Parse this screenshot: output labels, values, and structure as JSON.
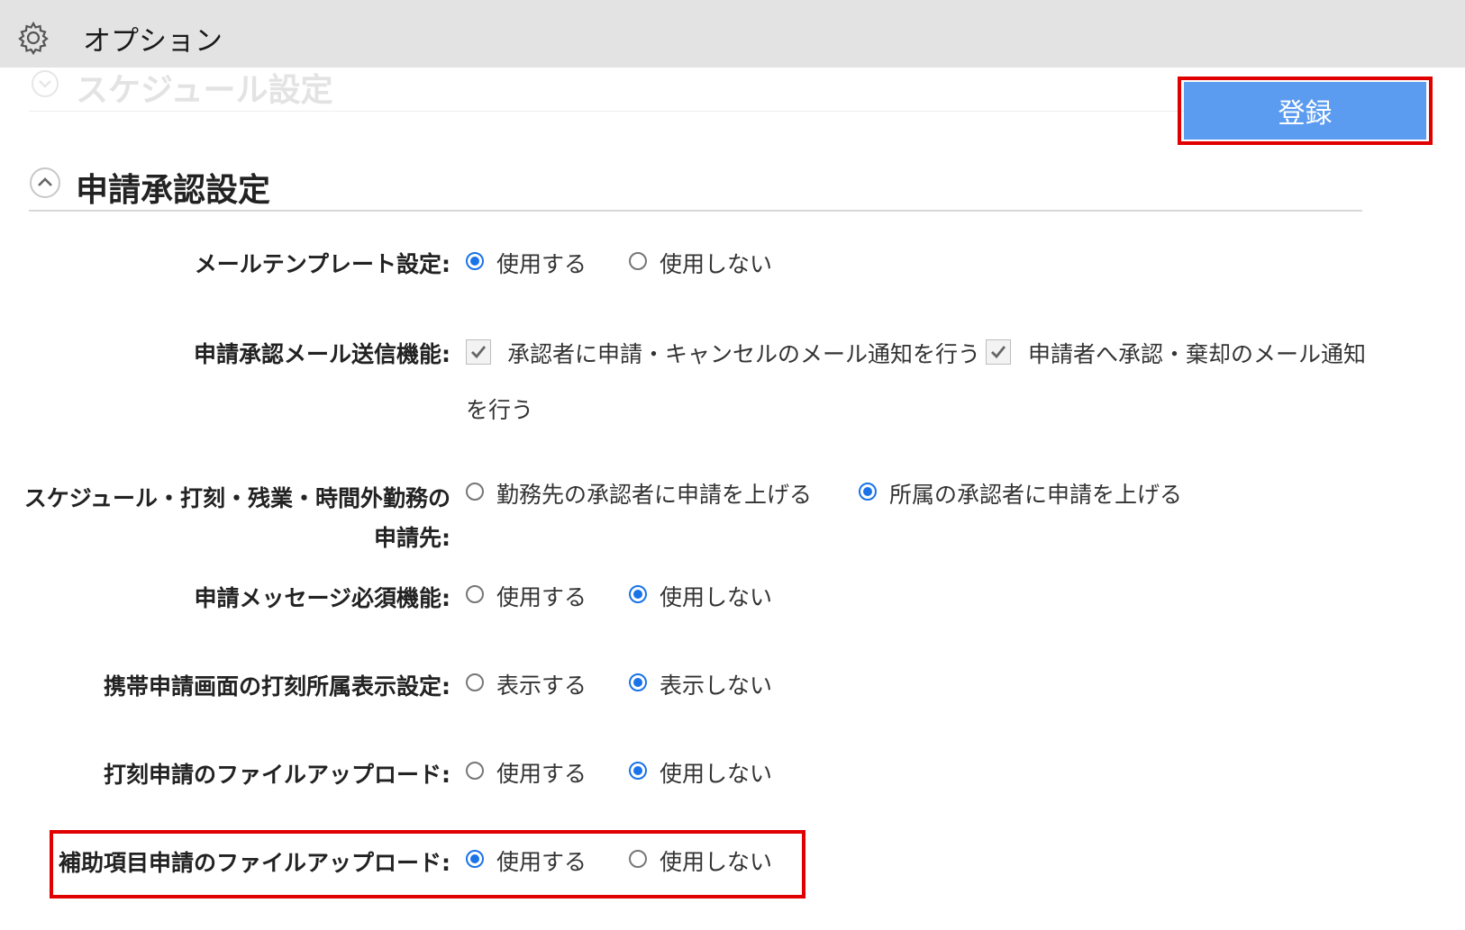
{
  "window": {
    "title": "オプション",
    "icon": "gear-icon"
  },
  "schedule_section": {
    "title": "スケジュール設定",
    "icon": "chevron-down-icon"
  },
  "register_button": {
    "label": "登録"
  },
  "approval_section": {
    "title": "申請承認設定",
    "icon": "chevron-up-icon"
  },
  "settings": {
    "mail_template": {
      "label": "メールテンプレート設定:",
      "options": [
        {
          "label": "使用する",
          "selected": true
        },
        {
          "label": "使用しない",
          "selected": false
        }
      ]
    },
    "mail_send": {
      "label": "申請承認メール送信機能:",
      "checkbox1": {
        "label": "承認者に申請・キャンセルのメール通知を行う",
        "checked": true
      },
      "checkbox2": {
        "label": "申請者へ承認・棄却のメール通知",
        "label_cont": "を行う",
        "checked": true
      }
    },
    "apply_to": {
      "label_line1": "スケジュール・打刻・残業・時間外勤務の",
      "label_line2": "申請先:",
      "options": [
        {
          "label": "勤務先の承認者に申請を上げる",
          "selected": false
        },
        {
          "label": "所属の承認者に申請を上げる",
          "selected": true
        }
      ]
    },
    "message_required": {
      "label": "申請メッセージ必須機能:",
      "options": [
        {
          "label": "使用する",
          "selected": false
        },
        {
          "label": "使用しない",
          "selected": true
        }
      ]
    },
    "mobile_display": {
      "label": "携帯申請画面の打刻所属表示設定:",
      "options": [
        {
          "label": "表示する",
          "selected": false
        },
        {
          "label": "表示しない",
          "selected": true
        }
      ]
    },
    "stamp_upload": {
      "label": "打刻申請のファイルアップロード:",
      "options": [
        {
          "label": "使用する",
          "selected": false
        },
        {
          "label": "使用しない",
          "selected": true
        }
      ]
    },
    "aux_upload": {
      "label": "補助項目申請のファイルアップロード:",
      "options": [
        {
          "label": "使用する",
          "selected": true
        },
        {
          "label": "使用しない",
          "selected": false
        }
      ]
    }
  },
  "colors": {
    "accent": "#1a73e8",
    "button": "#5b9cf0",
    "highlight": "#e00000"
  }
}
